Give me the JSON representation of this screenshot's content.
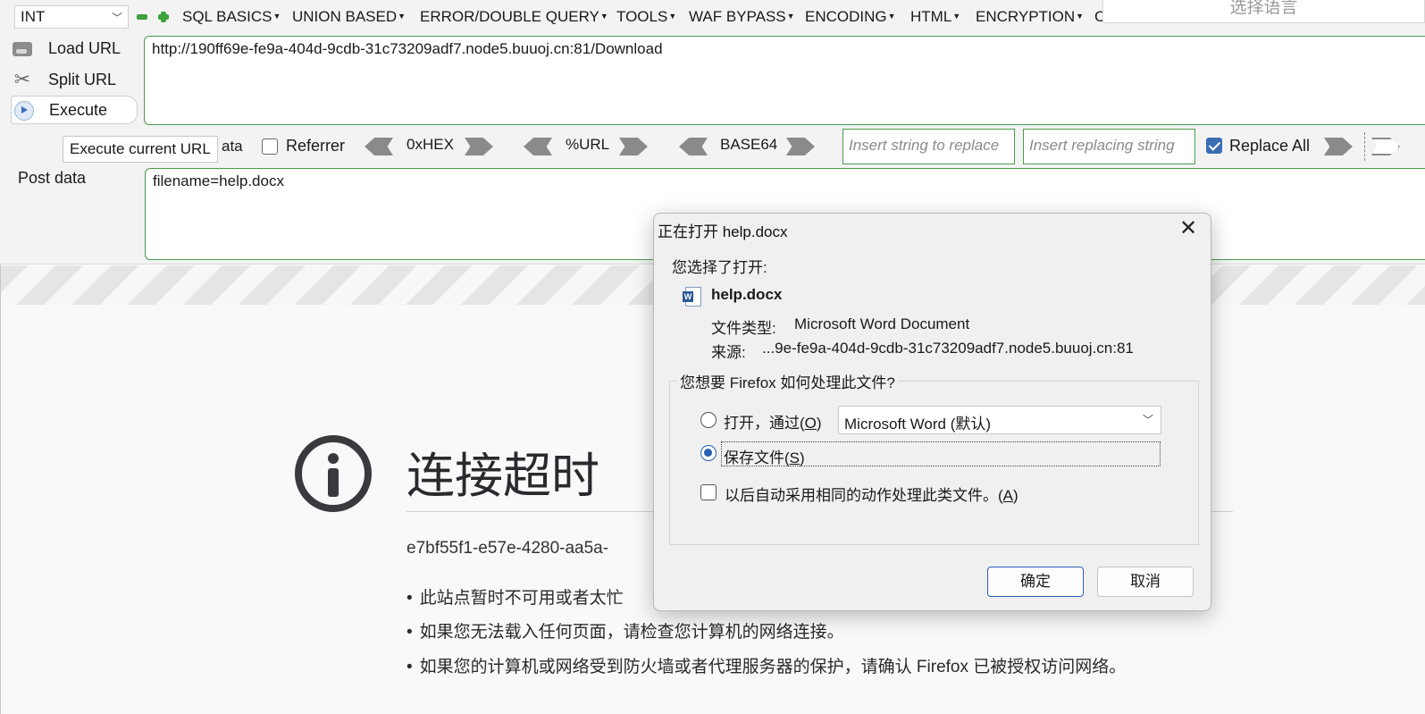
{
  "hackbar": {
    "int_select": "INT",
    "menus": [
      {
        "label": "SQL BASICS"
      },
      {
        "label": "UNION BASED"
      },
      {
        "label": "ERROR/DOUBLE QUERY"
      },
      {
        "label": "TOOLS"
      },
      {
        "label": "WAF BYPASS"
      },
      {
        "label": "ENCODING"
      },
      {
        "label": "HTML"
      },
      {
        "label": "ENCRYPTION"
      },
      {
        "label": "C"
      }
    ],
    "language_box": "选择语言",
    "load_url_label": "Load URL",
    "split_url_label": "Split URL",
    "execute_label": "Execute",
    "execute_tooltip": "Execute current URL",
    "url_value": "http://190ff69e-fe9a-404d-9cdb-31c73209adf7.node5.buuoj.cn:81/Download",
    "post_data_partial": "ata",
    "referrer_label": "Referrer",
    "hex_label": "0xHEX",
    "url_enc_label": "%URL",
    "base64_label": "BASE64",
    "replace_from_placeholder": "Insert string to replace",
    "replace_to_placeholder": "Insert replacing string",
    "replace_all_label": "Replace All",
    "post_data_label": "Post data",
    "post_data_value": "filename=help.docx"
  },
  "page": {
    "title": "连接超时",
    "error_id": "e7bf55f1-e57e-4280-aa5a-",
    "bullets": [
      "此站点暂时不可用或者太忙",
      "如果您无法载入任何页面，请检查您计算机的网络连接。",
      "如果您的计算机或网络受到防火墙或者代理服务器的保护，请确认 Firefox 已被授权访问网络。"
    ]
  },
  "dialog": {
    "title": "正在打开 help.docx",
    "close_glyph": "✕",
    "chose_label": "您选择了打开:",
    "filename": "help.docx",
    "type_label": "文件类型:",
    "type_value": "Microsoft Word Document",
    "source_label": "来源:",
    "source_value": "...9e-fe9a-404d-9cdb-31c73209adf7.node5.buuoj.cn:81",
    "group_title": "您想要 Firefox 如何处理此文件?",
    "open_with_label": "打开，通过",
    "open_with_key": "O",
    "open_with_app": "Microsoft Word (默认)",
    "save_label": "保存文件",
    "save_key": "S",
    "auto_label": "以后自动采用相同的动作处理此类文件。",
    "auto_key": "A",
    "ok_label": "确定",
    "cancel_label": "取消",
    "selected_option": "save"
  },
  "colors": {
    "accent_green": "#4b9b4b",
    "accent_blue": "#2b5fb3"
  }
}
